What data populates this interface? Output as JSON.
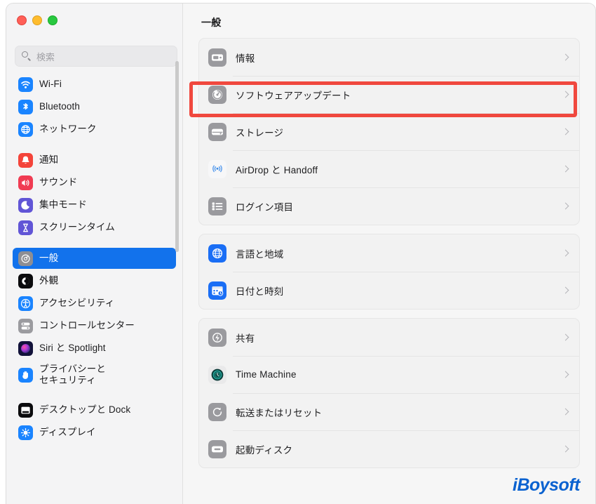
{
  "window": {
    "traffic_lights": [
      "close",
      "minimize",
      "zoom"
    ],
    "colors": {
      "close": "#ff5f57",
      "minimize": "#febc2e",
      "zoom": "#28c840",
      "accent_selected": "#1272ec",
      "highlight_red": "#f0483e",
      "watermark_blue": "#0a62d0"
    }
  },
  "search": {
    "placeholder": "検索",
    "value": "",
    "icon": "search-icon"
  },
  "sidebar": {
    "groups": [
      {
        "items": [
          {
            "label": "Wi-Fi",
            "icon": "wifi-icon",
            "selected": false
          },
          {
            "label": "Bluetooth",
            "icon": "bluetooth-icon",
            "selected": false
          },
          {
            "label": "ネットワーク",
            "icon": "network-icon",
            "selected": false
          }
        ]
      },
      {
        "items": [
          {
            "label": "通知",
            "icon": "bell-icon",
            "selected": false
          },
          {
            "label": "サウンド",
            "icon": "speaker-icon",
            "selected": false
          },
          {
            "label": "集中モード",
            "icon": "moon-icon",
            "selected": false
          },
          {
            "label": "スクリーンタイム",
            "icon": "hourglass-icon",
            "selected": false
          }
        ]
      },
      {
        "items": [
          {
            "label": "一般",
            "icon": "gear-icon",
            "selected": true
          },
          {
            "label": "外観",
            "icon": "appearance-icon",
            "selected": false
          },
          {
            "label": "アクセシビリティ",
            "icon": "accessibility-icon",
            "selected": false
          },
          {
            "label": "コントロールセンター",
            "icon": "control-center-icon",
            "selected": false
          },
          {
            "label": "Siri と Spotlight",
            "icon": "siri-icon",
            "selected": false
          },
          {
            "label": "プライバシーと\nセキュリティ",
            "icon": "privacy-hand-icon",
            "selected": false
          }
        ]
      },
      {
        "items": [
          {
            "label": "デスクトップと Dock",
            "icon": "desktop-dock-icon",
            "selected": false
          },
          {
            "label": "ディスプレイ",
            "icon": "display-icon",
            "selected": false
          }
        ]
      }
    ]
  },
  "main": {
    "title": "一般",
    "groups": [
      {
        "rows": [
          {
            "label": "情報",
            "icon": "about-icon",
            "chevron": "chevron-right-icon"
          },
          {
            "label": "ソフトウェアアップデート",
            "icon": "software-update-icon",
            "chevron": "chevron-right-icon",
            "highlighted": true
          },
          {
            "label": "ストレージ",
            "icon": "storage-icon",
            "chevron": "chevron-right-icon"
          },
          {
            "label": "AirDrop と Handoff",
            "icon": "airdrop-icon",
            "chevron": "chevron-right-icon"
          },
          {
            "label": "ログイン項目",
            "icon": "login-items-icon",
            "chevron": "chevron-right-icon"
          }
        ]
      },
      {
        "rows": [
          {
            "label": "言語と地域",
            "icon": "language-region-icon",
            "chevron": "chevron-right-icon"
          },
          {
            "label": "日付と時刻",
            "icon": "date-time-icon",
            "chevron": "chevron-right-icon"
          }
        ]
      },
      {
        "rows": [
          {
            "label": "共有",
            "icon": "sharing-icon",
            "chevron": "chevron-right-icon"
          },
          {
            "label": "Time Machine",
            "icon": "time-machine-icon",
            "chevron": "chevron-right-icon"
          },
          {
            "label": "転送またはリセット",
            "icon": "transfer-reset-icon",
            "chevron": "chevron-right-icon"
          },
          {
            "label": "起動ディスク",
            "icon": "startup-disk-icon",
            "chevron": "chevron-right-icon"
          }
        ]
      }
    ]
  },
  "watermark": {
    "text": "iBoysoft"
  }
}
